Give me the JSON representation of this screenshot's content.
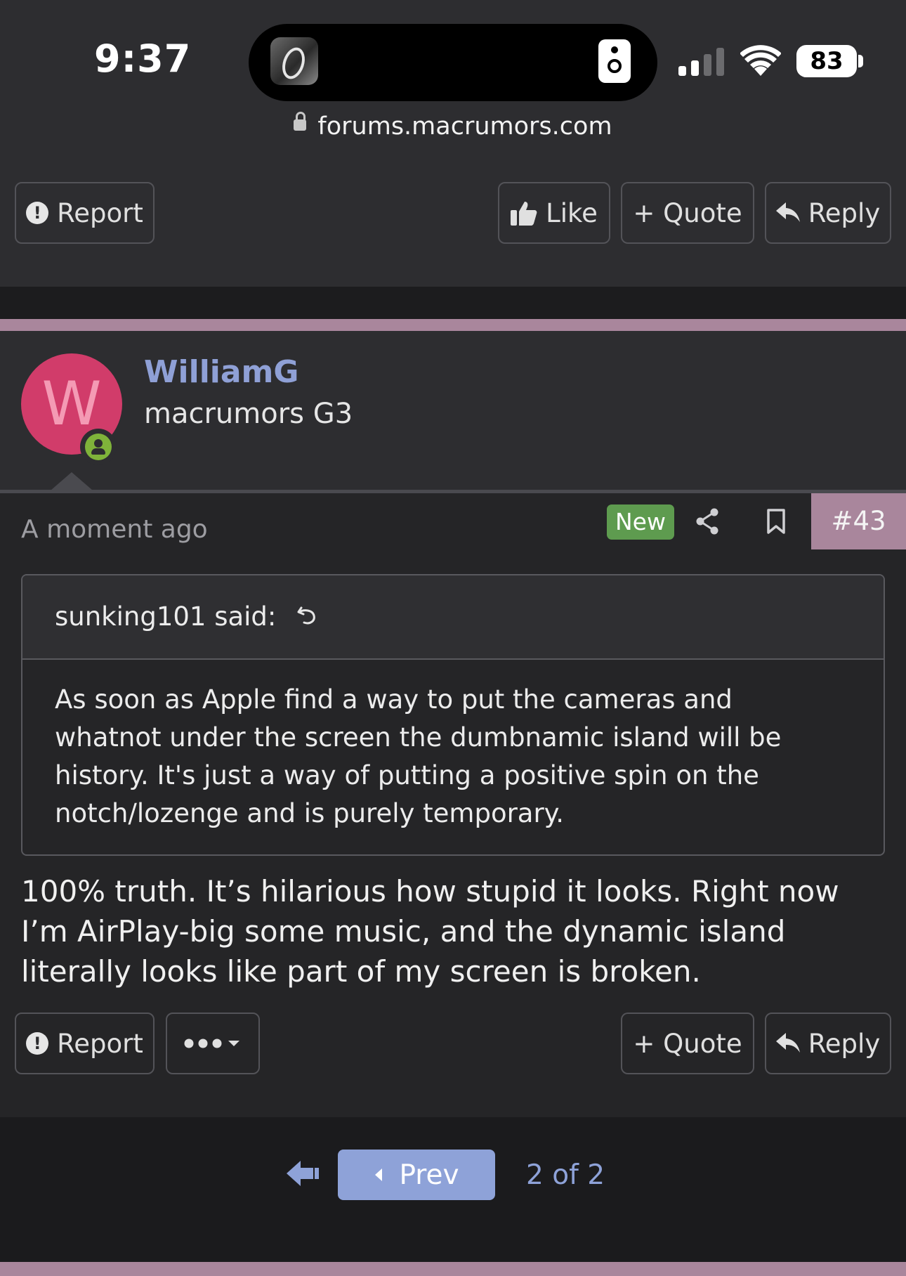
{
  "status_bar": {
    "time": "9:37",
    "battery": "83"
  },
  "browser": {
    "url": "forums.macrumors.com"
  },
  "top_actions": {
    "report": "Report",
    "like": "Like",
    "quote": "+ Quote",
    "reply": "Reply"
  },
  "post": {
    "username": "WilliamG",
    "user_title": "macrumors G3",
    "avatar_letter": "W",
    "time": "A moment ago",
    "new_badge": "New",
    "post_number": "#43",
    "quote": {
      "header": "sunking101 said:",
      "lines": [
        "As soon as Apple find a way to put the cameras and",
        "whatnot under the screen the dumbnamic island will be",
        "history. It's just a way of putting a positive spin on the",
        "notch/lozenge and is purely temporary."
      ]
    },
    "body_lines": [
      "100% truth. It’s hilarious how stupid it looks. Right now",
      "I’m AirPlay-big some music, and the dynamic island",
      "literally looks like part of my screen is broken."
    ],
    "actions": {
      "report": "Report",
      "quote": "+ Quote",
      "reply": "Reply"
    }
  },
  "pagination": {
    "prev": "Prev",
    "indicator": "2 of 2"
  },
  "colors": {
    "accent": "#a9869c",
    "username": "#8fa0d6",
    "new_badge": "#5e9b4f",
    "avatar": "#d13c6a",
    "pager": "#8ea2d8"
  }
}
